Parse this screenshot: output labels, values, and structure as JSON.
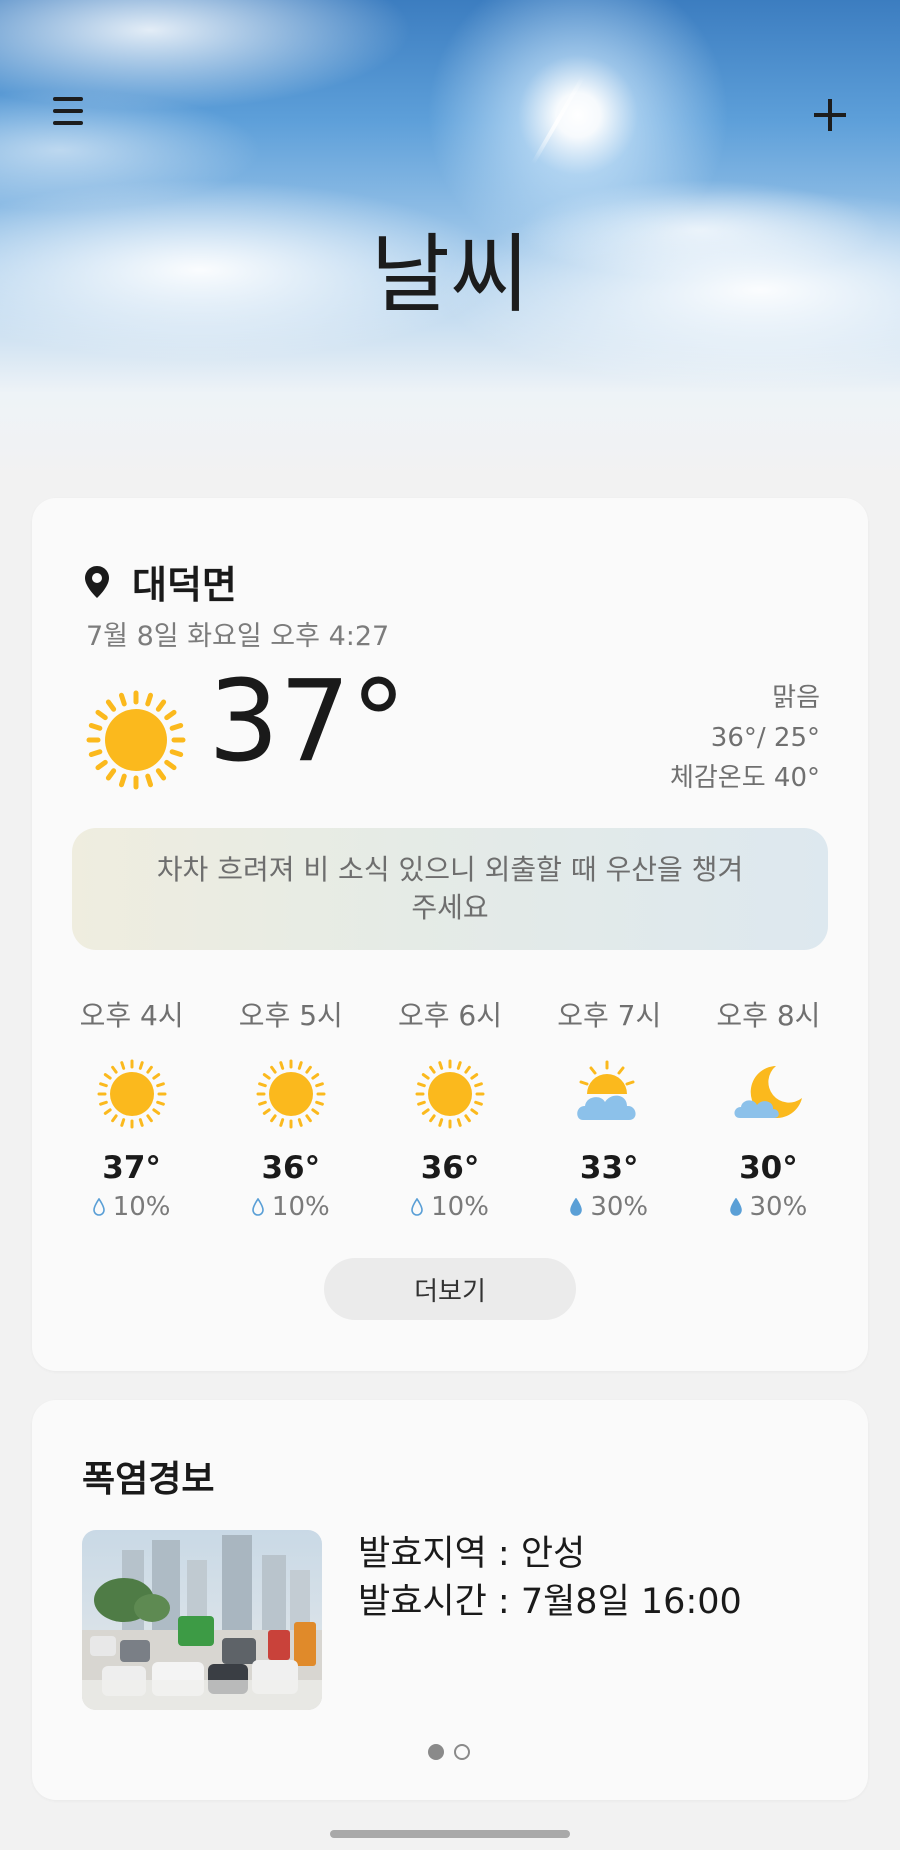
{
  "header": {
    "title": "날씨"
  },
  "current": {
    "location": "대덕면",
    "datetime": "7월 8일 화요일 오후 4:27",
    "temperature": "37°",
    "condition": "맑음",
    "high_low": "36°/ 25°",
    "feels_like": "체감온도 40°",
    "icon": "sun-icon"
  },
  "advice": "차차 흐려져 비 소식 있으니 외출할 때 우산을 챙겨주세요",
  "hourly": [
    {
      "time": "오후 4시",
      "temp": "37°",
      "precip": "10%",
      "icon": "sun-icon"
    },
    {
      "time": "오후 5시",
      "temp": "36°",
      "precip": "10%",
      "icon": "sun-icon"
    },
    {
      "time": "오후 6시",
      "temp": "36°",
      "precip": "10%",
      "icon": "sun-icon"
    },
    {
      "time": "오후 7시",
      "temp": "33°",
      "precip": "30%",
      "icon": "partly-cloudy-icon"
    },
    {
      "time": "오후 8시",
      "temp": "30°",
      "precip": "30%",
      "icon": "cloudy-night-icon"
    }
  ],
  "more_label": "더보기",
  "alert": {
    "title": "폭염경보",
    "region": "발효지역 : 안성",
    "time": "발효시간 : 7월8일 16:00",
    "pages": 2,
    "active_page": 1
  },
  "colors": {
    "sun": "#fbb91d",
    "cloud": "#8cc1ea",
    "background": "#f2f2f2",
    "card": "#fafafa"
  }
}
